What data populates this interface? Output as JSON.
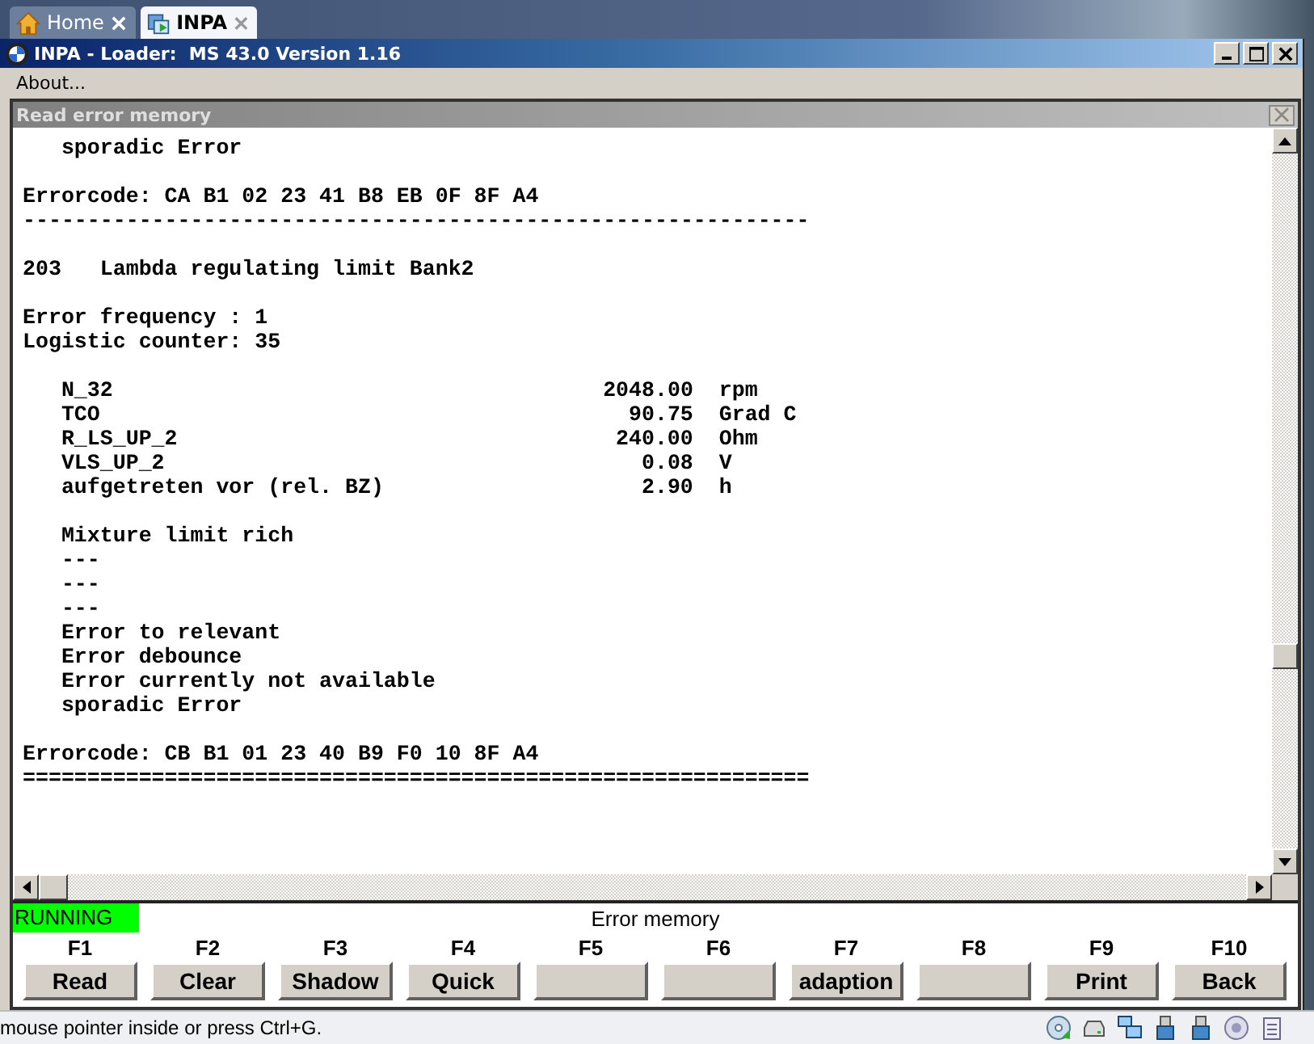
{
  "tabs": [
    {
      "label": "Home",
      "selected": false
    },
    {
      "label": "INPA",
      "selected": true
    }
  ],
  "window": {
    "title": "INPA - Loader:  MS 43.0 Version 1.16"
  },
  "menu": [
    "About..."
  ],
  "panel": {
    "title": "Read error memory",
    "lines": [
      {
        "kind": "text",
        "text": "   sporadic Error"
      },
      {
        "kind": "blank"
      },
      {
        "kind": "text",
        "text": "Errorcode: CA B1 02 23 41 B8 EB 0F 8F A4"
      },
      {
        "kind": "text",
        "text": "-------------------------------------------------------------"
      },
      {
        "kind": "blank"
      },
      {
        "kind": "text",
        "text": "203   Lambda regulating limit Bank2"
      },
      {
        "kind": "blank"
      },
      {
        "kind": "text",
        "text": "Error frequency : 1"
      },
      {
        "kind": "text",
        "text": "Logistic counter: 35"
      },
      {
        "kind": "blank"
      },
      {
        "kind": "param",
        "name": "N_32",
        "value": "2048.00",
        "unit": "rpm"
      },
      {
        "kind": "param",
        "name": "TCO",
        "value": "90.75",
        "unit": "Grad C"
      },
      {
        "kind": "param",
        "name": "R_LS_UP_2",
        "value": "240.00",
        "unit": "Ohm"
      },
      {
        "kind": "param",
        "name": "VLS_UP_2",
        "value": "0.08",
        "unit": "V"
      },
      {
        "kind": "param",
        "name": "aufgetreten vor (rel. BZ)",
        "value": "2.90",
        "unit": "h"
      },
      {
        "kind": "blank"
      },
      {
        "kind": "text",
        "text": "   Mixture limit rich"
      },
      {
        "kind": "text",
        "text": "   ---"
      },
      {
        "kind": "text",
        "text": "   ---"
      },
      {
        "kind": "text",
        "text": "   ---"
      },
      {
        "kind": "text",
        "text": "   Error to relevant"
      },
      {
        "kind": "text",
        "text": "   Error debounce"
      },
      {
        "kind": "text",
        "text": "   Error currently not available"
      },
      {
        "kind": "text",
        "text": "   sporadic Error"
      },
      {
        "kind": "blank"
      },
      {
        "kind": "text",
        "text": "Errorcode: CB B1 01 23 40 B9 F0 10 8F A4"
      },
      {
        "kind": "text",
        "text": "============================================================="
      }
    ]
  },
  "status": {
    "state": "RUNNING",
    "title": "Error memory"
  },
  "function_keys": [
    {
      "key": "F1",
      "label": "Read"
    },
    {
      "key": "F2",
      "label": "Clear"
    },
    {
      "key": "F3",
      "label": "Shadow"
    },
    {
      "key": "F4",
      "label": "Quick"
    },
    {
      "key": "F5"
    },
    {
      "key": "F6"
    },
    {
      "key": "F7",
      "label": "adaption"
    },
    {
      "key": "F8"
    },
    {
      "key": "F9",
      "label": "Print"
    },
    {
      "key": "F10",
      "label": "Back"
    }
  ],
  "status_bar": "mouse pointer inside or press Ctrl+G."
}
